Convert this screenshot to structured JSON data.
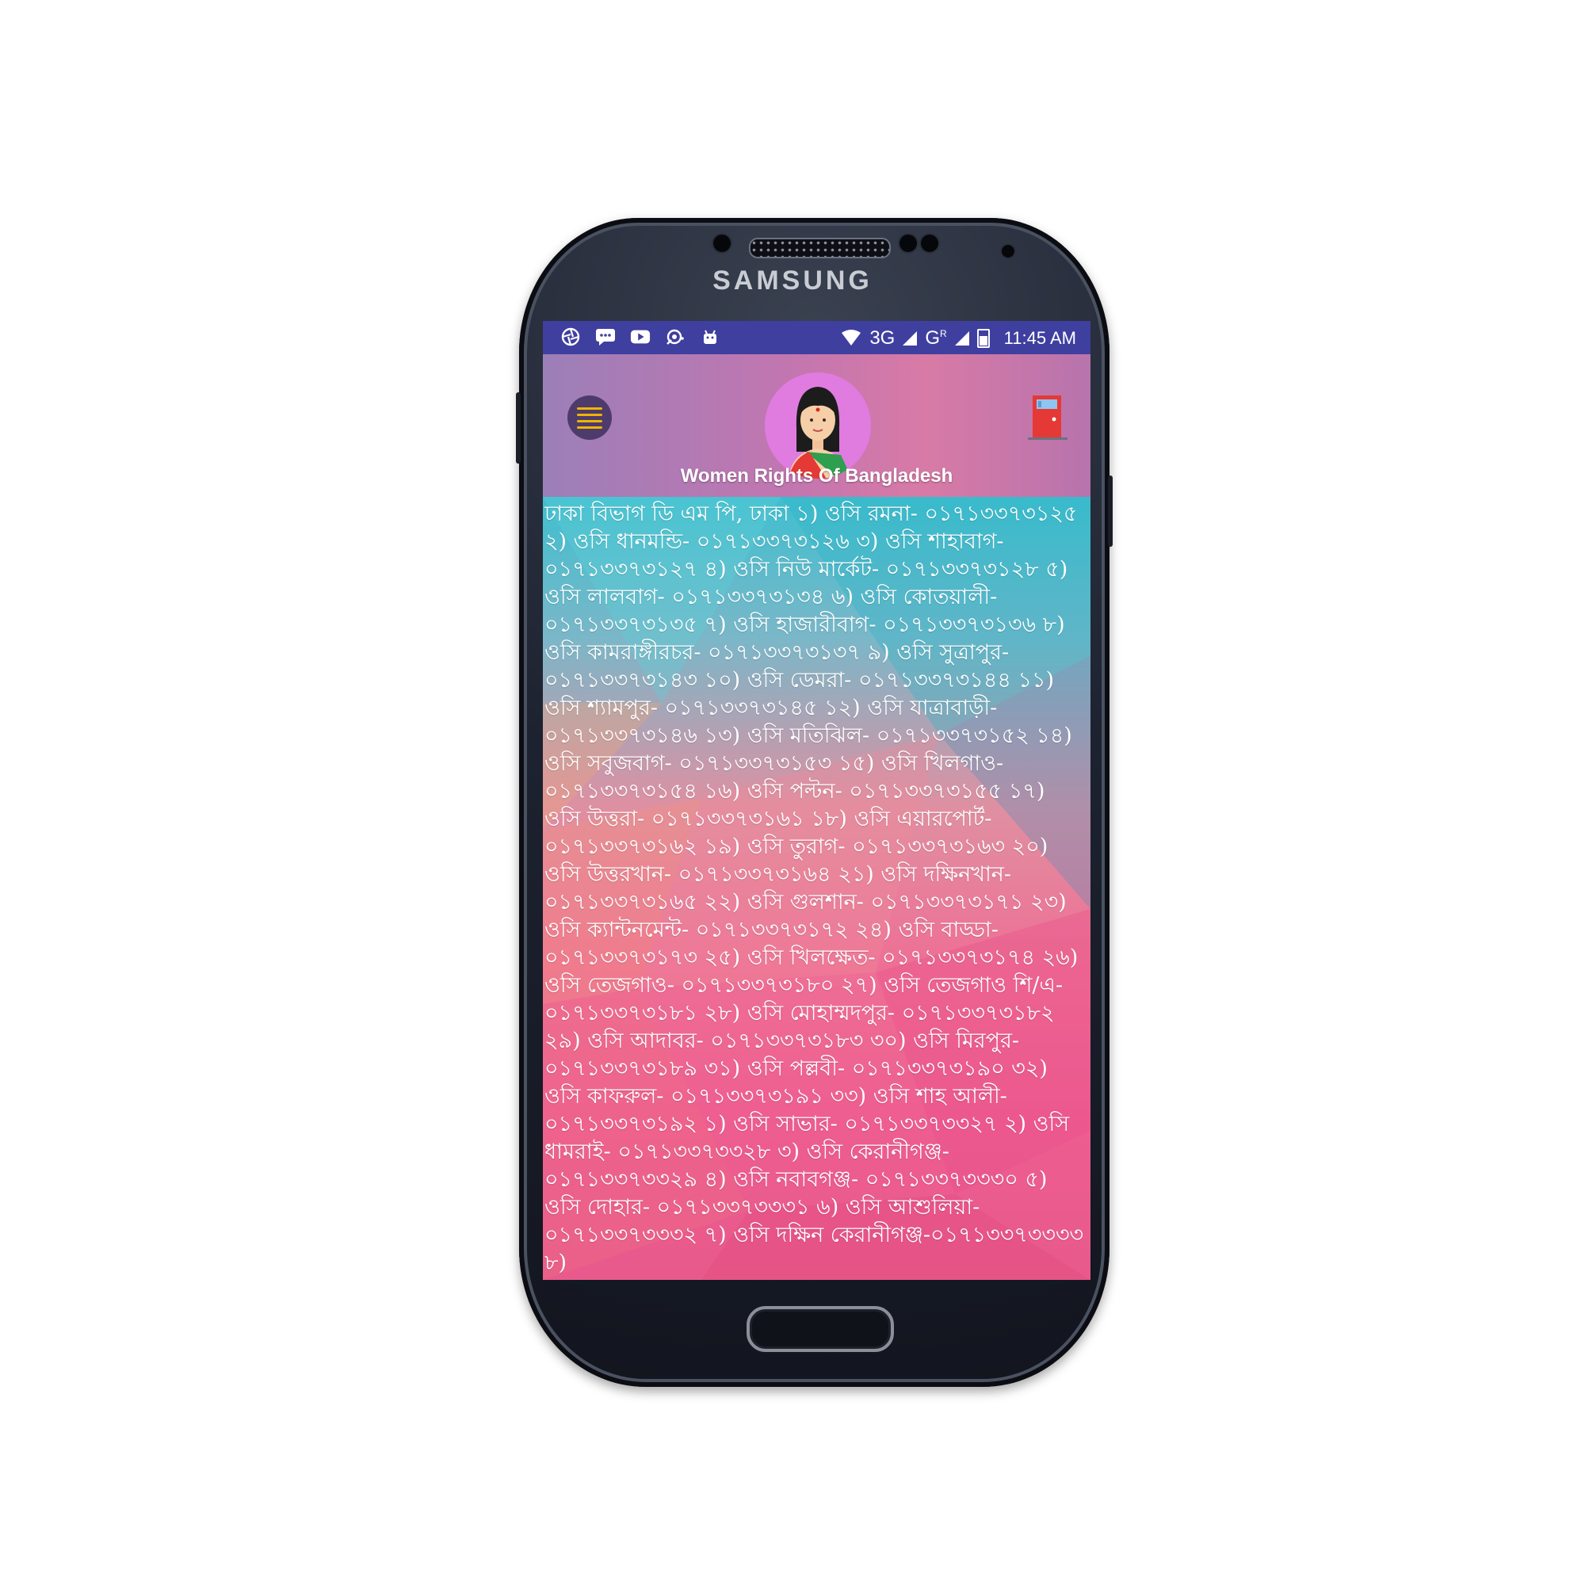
{
  "device": {
    "brand": "SAMSUNG"
  },
  "statusbar": {
    "left_icons": [
      "aperture-icon",
      "message-icon",
      "youtube-icon",
      "radio-icon",
      "android-icon"
    ],
    "network_3g": "3G",
    "network_g": "G",
    "network_g_sup": "R",
    "time": "11:45 AM"
  },
  "header": {
    "title": "Women Rights Of Bangladesh",
    "menu_icon": "hamburger-menu-icon",
    "exit_icon": "door-exit-icon"
  },
  "colors": {
    "statusbar": "#3f3fa0",
    "menu_button": "#4d3b6b",
    "menu_lines": "#f0b400",
    "avatar_bg": "#e07be0",
    "door": "#e53935"
  },
  "content": {
    "text": "ঢাকা বিভাগ ডি এম পি, ঢাকা ১) ওসি রমনা- ০১৭১৩৩৭৩১২৫ ২) ওসি ধানমন্ডি- ০১৭১৩৩৭৩১২৬ ৩) ওসি শাহাবাগ- ০১৭১৩৩৭৩১২৭ ৪) ওসি নিউ মার্কেট- ০১৭১৩৩৭৩১২৮ ৫) ওসি লালবাগ- ০১৭১৩৩৭৩১৩৪ ৬) ওসি কোতয়ালী- ০১৭১৩৩৭৩১৩৫ ৭) ওসি হাজারীবাগ- ০১৭১৩৩৭৩১৩৬ ৮) ওসি কামরাঙ্গীরচর- ০১৭১৩৩৭৩১৩৭ ৯) ওসি সুত্রাপুর- ০১৭১৩৩৭৩১৪৩ ১০) ওসি ডেমরা- ০১৭১৩৩৭৩১৪৪ ১১) ওসি শ্যামপুর- ০১৭১৩৩৭৩১৪৫ ১২) ওসি যাত্রাবাড়ী- ০১৭১৩৩৭৩১৪৬ ১৩) ওসি মতিঝিল- ০১৭১৩৩৭৩১৫২ ১৪) ওসি সবুজবাগ- ০১৭১৩৩৭৩১৫৩ ১৫) ওসি খিলগাও- ০১৭১৩৩৭৩১৫৪ ১৬) ওসি পল্টন- ০১৭১৩৩৭৩১৫৫ ১৭) ওসি উত্তরা- ০১৭১৩৩৭৩১৬১ ১৮) ওসি এয়ারপোর্ট- ০১৭১৩৩৭৩১৬২ ১৯) ওসি তুরাগ- ০১৭১৩৩৭৩১৬৩ ২০) ওসি উত্তরখান- ০১৭১৩৩৭৩১৬৪ ২১) ওসি দক্ষিনখান- ০১৭১৩৩৭৩১৬৫ ২২) ওসি গুলশান- ০১৭১৩৩৭৩১৭১ ২৩) ওসি ক্যান্টনমেন্ট- ০১৭১৩৩৭৩১৭২ ২৪) ওসি বাড্ডা- ০১৭১৩৩৭৩১৭৩ ২৫) ওসি খিলক্ষেত- ০১৭১৩৩৭৩১৭৪ ২৬) ওসি তেজগাও- ০১৭১৩৩৭৩১৮০ ২৭) ওসি তেজগাও শি/এ- ০১৭১৩৩৭৩১৮১ ২৮) ওসি মোহাম্মদপুর- ০১৭১৩৩৭৩১৮২ ২৯) ওসি আদাবর- ০১৭১৩৩৭৩১৮৩ ৩০) ওসি মিরপুর- ০১৭১৩৩৭৩১৮৯ ৩১) ওসি পল্লবী- ০১৭১৩৩৭৩১৯০ ৩২) ওসি কাফরুল- ০১৭১৩৩৭৩১৯১ ৩৩) ওসি শাহ আলী- ০১৭১৩৩৭৩১৯২ ১) ওসি সাভার- ০১৭১৩৩৭৩৩২৭ ২) ওসি ধামরাই- ০১৭১৩৩৭৩৩২৮ ৩) ওসি কেরানীগঞ্জ- ০১৭১৩৩৭৩৩২৯ ৪) ওসি নবাবগঞ্জ- ০১৭১৩৩৭৩৩৩০ ৫) ওসি দোহার- ০১৭১৩৩৭৩৩৩১ ৬) ওসি আশুলিয়া- ০১৭১৩৩৭৩৩৩২ ৭) ওসি দক্ষিন কেরানীগঞ্জ-০১৭১৩৩৭৩৩৩৩ ৮)"
  }
}
